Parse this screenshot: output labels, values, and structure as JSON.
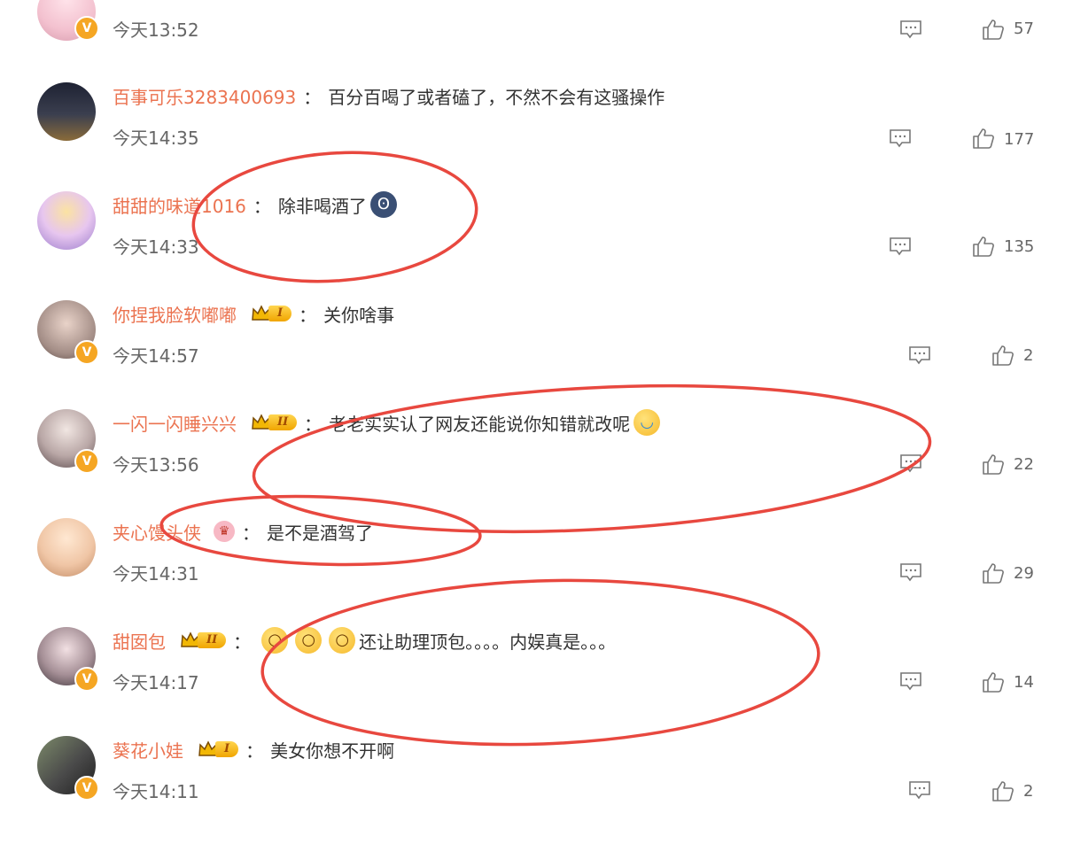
{
  "comments": [
    {
      "username": "",
      "text": "",
      "time": "今天13:52",
      "likes": "57",
      "verified": true,
      "avatar_color": "#f3c1cf"
    },
    {
      "username": "百事可乐3283400693",
      "text": "百分百喝了或者磕了，不然不会有这骚操作",
      "time": "今天14:35",
      "likes": "177",
      "verified": false,
      "avatar_color": "#3b3f4f"
    },
    {
      "username": "甜甜的味道1016",
      "text": "除非喝酒了",
      "time": "今天14:33",
      "likes": "135",
      "verified": false,
      "avatar_color": "#c9a9e0"
    },
    {
      "username": "你捏我脸软嘟嘟",
      "text": "关你啥事",
      "time": "今天14:57",
      "likes": "2",
      "verified": true,
      "avatar_color": "#a38d86",
      "badge_level": "I"
    },
    {
      "username": "一闪一闪睡兴兴",
      "text": "老老实实认了网友还能说你知错就改呢",
      "time": "今天13:56",
      "likes": "22",
      "verified": true,
      "avatar_color": "#8a7b80",
      "badge_level": "II"
    },
    {
      "username": "夹心馒头侠",
      "text": "是不是酒驾了",
      "time": "今天14:31",
      "likes": "29",
      "verified": false,
      "avatar_color": "#f0c6a6"
    },
    {
      "username": "甜囡包",
      "text": "还让助理顶包。。。。内娱真是。。。",
      "time": "今天14:17",
      "likes": "14",
      "verified": true,
      "avatar_color": "#5d5560",
      "badge_level": "II"
    },
    {
      "username": "葵花小娃",
      "text": "美女你想不开啊",
      "time": "今天14:11",
      "likes": "2",
      "verified": true,
      "avatar_color": "#4a4a4a",
      "badge_level": "I"
    }
  ],
  "icons": {
    "reply": "comment-bubble-icon",
    "like": "thumbs-up-icon",
    "verified": "verified-v-badge-icon",
    "crown": "crown-membership-icon"
  },
  "colors": {
    "username": "#eb7350",
    "annotation": "#e8483f",
    "verified_badge": "#f5a623"
  },
  "verified_mark": "V"
}
